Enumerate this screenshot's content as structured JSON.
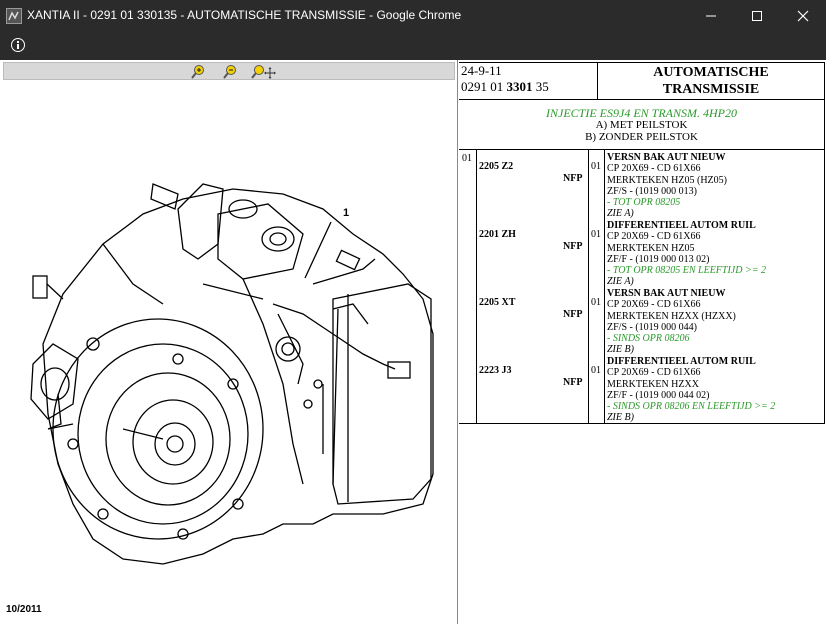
{
  "window": {
    "title": "XANTIA II - 0291 01 330135 - AUTOMATISCHE TRANSMISSIE - Google Chrome",
    "minimize": "—",
    "maximize": "☐",
    "close": "✕"
  },
  "drawing": {
    "callout": "1",
    "date": "10/2011"
  },
  "header": {
    "date": "24-9-11",
    "code_prefix": "0291 01 ",
    "code_bold": "3301",
    "code_suffix": " 35",
    "title_line1": "AUTOMATISCHE",
    "title_line2": "TRANSMISSIE"
  },
  "description": {
    "green_line": "INJECTIE ES9J4 EN TRANSM. 4HP20",
    "line_a": "A) MET PEILSTOK",
    "line_b": "B) ZONDER PEILSTOK"
  },
  "parts": {
    "item_no": "01",
    "rows": [
      {
        "ref": "2205 Z2",
        "nfp": "NFP",
        "qty": "01",
        "name": "VERSN BAK AUT NIEUW",
        "dims": "CP 20X69 - CD 61X66",
        "mark": "MERKTEKEN HZ05 (HZ05)",
        "zf": "ZF/S - (1019 000 013)",
        "cond": "- TOT OPR 08205",
        "see": "ZIE A)"
      },
      {
        "ref": "2201 ZH",
        "nfp": "NFP",
        "qty": "01",
        "name": "DIFFERENTIEEL AUTOM RUIL",
        "dims": "CP 20X69 - CD 61X66",
        "mark": "MERKTEKEN HZ05",
        "zf": "ZF/F - (1019 000 013 02)",
        "cond": "- TOT OPR 08205 EN LEEFTIJD >= 2",
        "see": "ZIE A)"
      },
      {
        "ref": "2205 XT",
        "nfp": "NFP",
        "qty": "01",
        "name": "VERSN BAK AUT NIEUW",
        "dims": "CP 20X69 - CD 61X66",
        "mark": "MERKTEKEN HZXX (HZXX)",
        "zf": "ZF/S - (1019 000 044)",
        "cond": "- SINDS OPR 08206",
        "see": "ZIE B)"
      },
      {
        "ref": "2223 J3",
        "nfp": "NFP",
        "qty": "01",
        "name": "DIFFERENTIEEL AUTOM RUIL",
        "dims": "CP 20X69 - CD 61X66",
        "mark": "MERKTEKEN HZXX",
        "zf": "ZF/F - (1019 000 044 02)",
        "cond": "- SINDS OPR 08206 EN LEEFTIJD >= 2",
        "see": "ZIE B)"
      }
    ]
  }
}
